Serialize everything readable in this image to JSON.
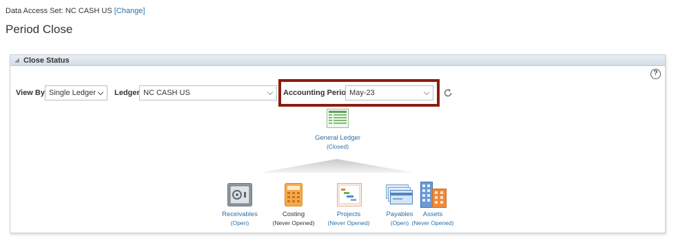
{
  "header": {
    "data_access_label": "Data Access Set:",
    "data_access_value": "NC CASH US",
    "change_link": "[Change]",
    "page_title": "Period Close"
  },
  "close_status": {
    "title": "Close Status",
    "help": "?",
    "view_by_label": "View By",
    "view_by_value": "Single Ledger",
    "ledger_label": "Ledger",
    "ledger_value": "NC CASH US",
    "accounting_period_label": "Accounting Period",
    "accounting_period_value": "May-23",
    "highlight_color": "#8c1c0f"
  },
  "general_ledger": {
    "name": "General Ledger",
    "status": "(Closed)"
  },
  "modules": [
    {
      "name": "Receivables",
      "status": "(Open)",
      "icon": "safe-icon"
    },
    {
      "name": "Costing",
      "status": "(Never Opened)",
      "icon": "calculator-icon"
    },
    {
      "name": "Projects",
      "status": "(Never Opened)",
      "icon": "gantt-chart-icon"
    },
    {
      "name": "Payables",
      "status": "(Open)",
      "icon": "cards-icon"
    },
    {
      "name": "Assets",
      "status": "(Never Opened)",
      "icon": "buildings-icon"
    }
  ]
}
